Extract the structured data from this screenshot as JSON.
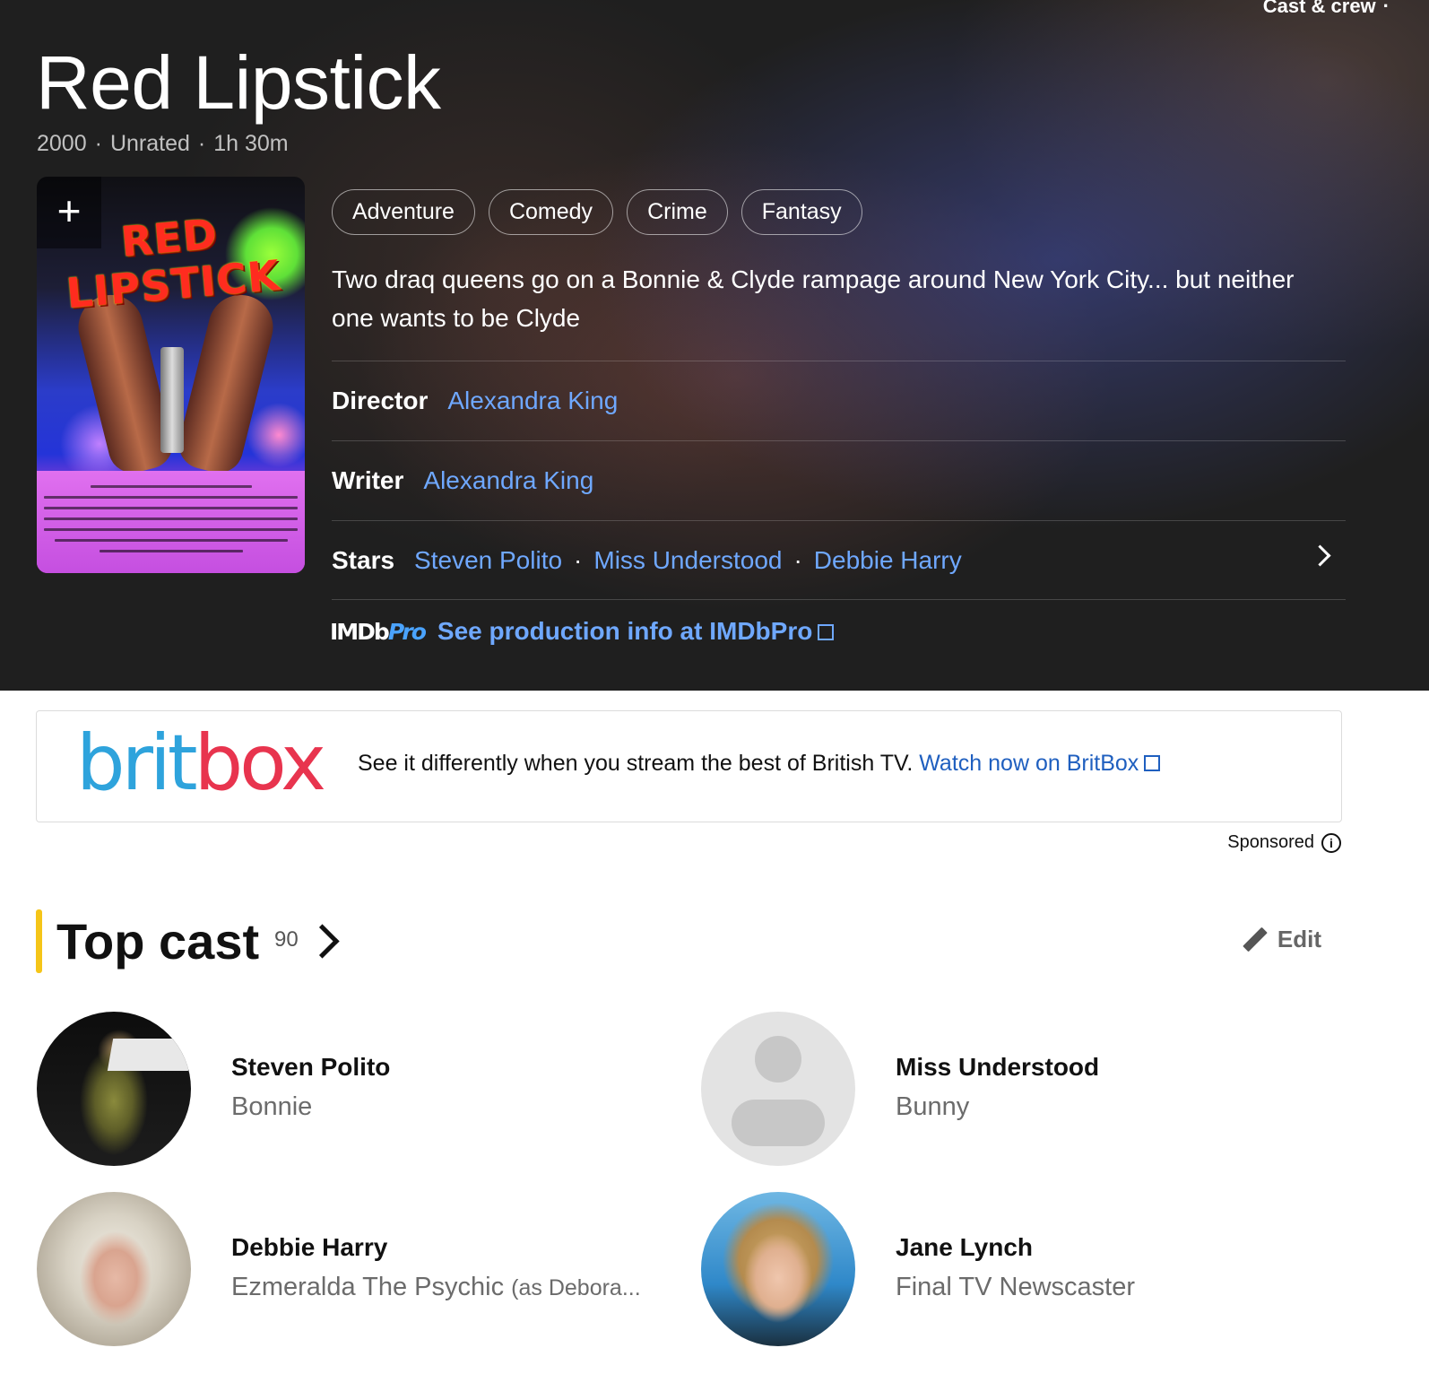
{
  "header": {
    "cast_crew_link": "Cast & crew",
    "title": "Red Lipstick",
    "year": "2000",
    "rating": "Unrated",
    "runtime": "1h 30m"
  },
  "poster": {
    "title_text": "RED LIPSTICK",
    "add_icon": "plus-icon"
  },
  "genres": [
    "Adventure",
    "Comedy",
    "Crime",
    "Fantasy"
  ],
  "plot": "Two draq queens go on a Bonnie & Clyde rampage around New York City... but neither one wants to be Clyde",
  "credits": {
    "director_label": "Director",
    "director": "Alexandra King",
    "writer_label": "Writer",
    "writer": "Alexandra King",
    "stars_label": "Stars",
    "stars": [
      "Steven Polito",
      "Miss Understood",
      "Debbie Harry"
    ]
  },
  "imdbpro": {
    "logo_main": "IMDb",
    "logo_pro": "Pro",
    "link": "See production info at IMDbPro"
  },
  "ad": {
    "brand_brit": "brit",
    "brand_box": "box",
    "text": "See it differently when you stream the best of British TV.",
    "link": "Watch now on BritBox",
    "sponsored": "Sponsored"
  },
  "top_cast": {
    "title": "Top cast",
    "count": "90",
    "edit_label": "Edit",
    "members": [
      {
        "name": "Steven Polito",
        "role": "Bonnie",
        "role_note": ""
      },
      {
        "name": "Miss Understood",
        "role": "Bunny",
        "role_note": ""
      },
      {
        "name": "Debbie Harry",
        "role": "Ezmeralda The Psychic",
        "role_note": "(as Debora..."
      },
      {
        "name": "Jane Lynch",
        "role": "Final TV Newscaster",
        "role_note": ""
      }
    ]
  },
  "colors": {
    "link_dark_bg": "#6fa8ff",
    "link_light_bg": "#1f5fbf",
    "accent": "#f5c518",
    "britbox_blue": "#2ea3dc",
    "britbox_red": "#e8344e"
  }
}
